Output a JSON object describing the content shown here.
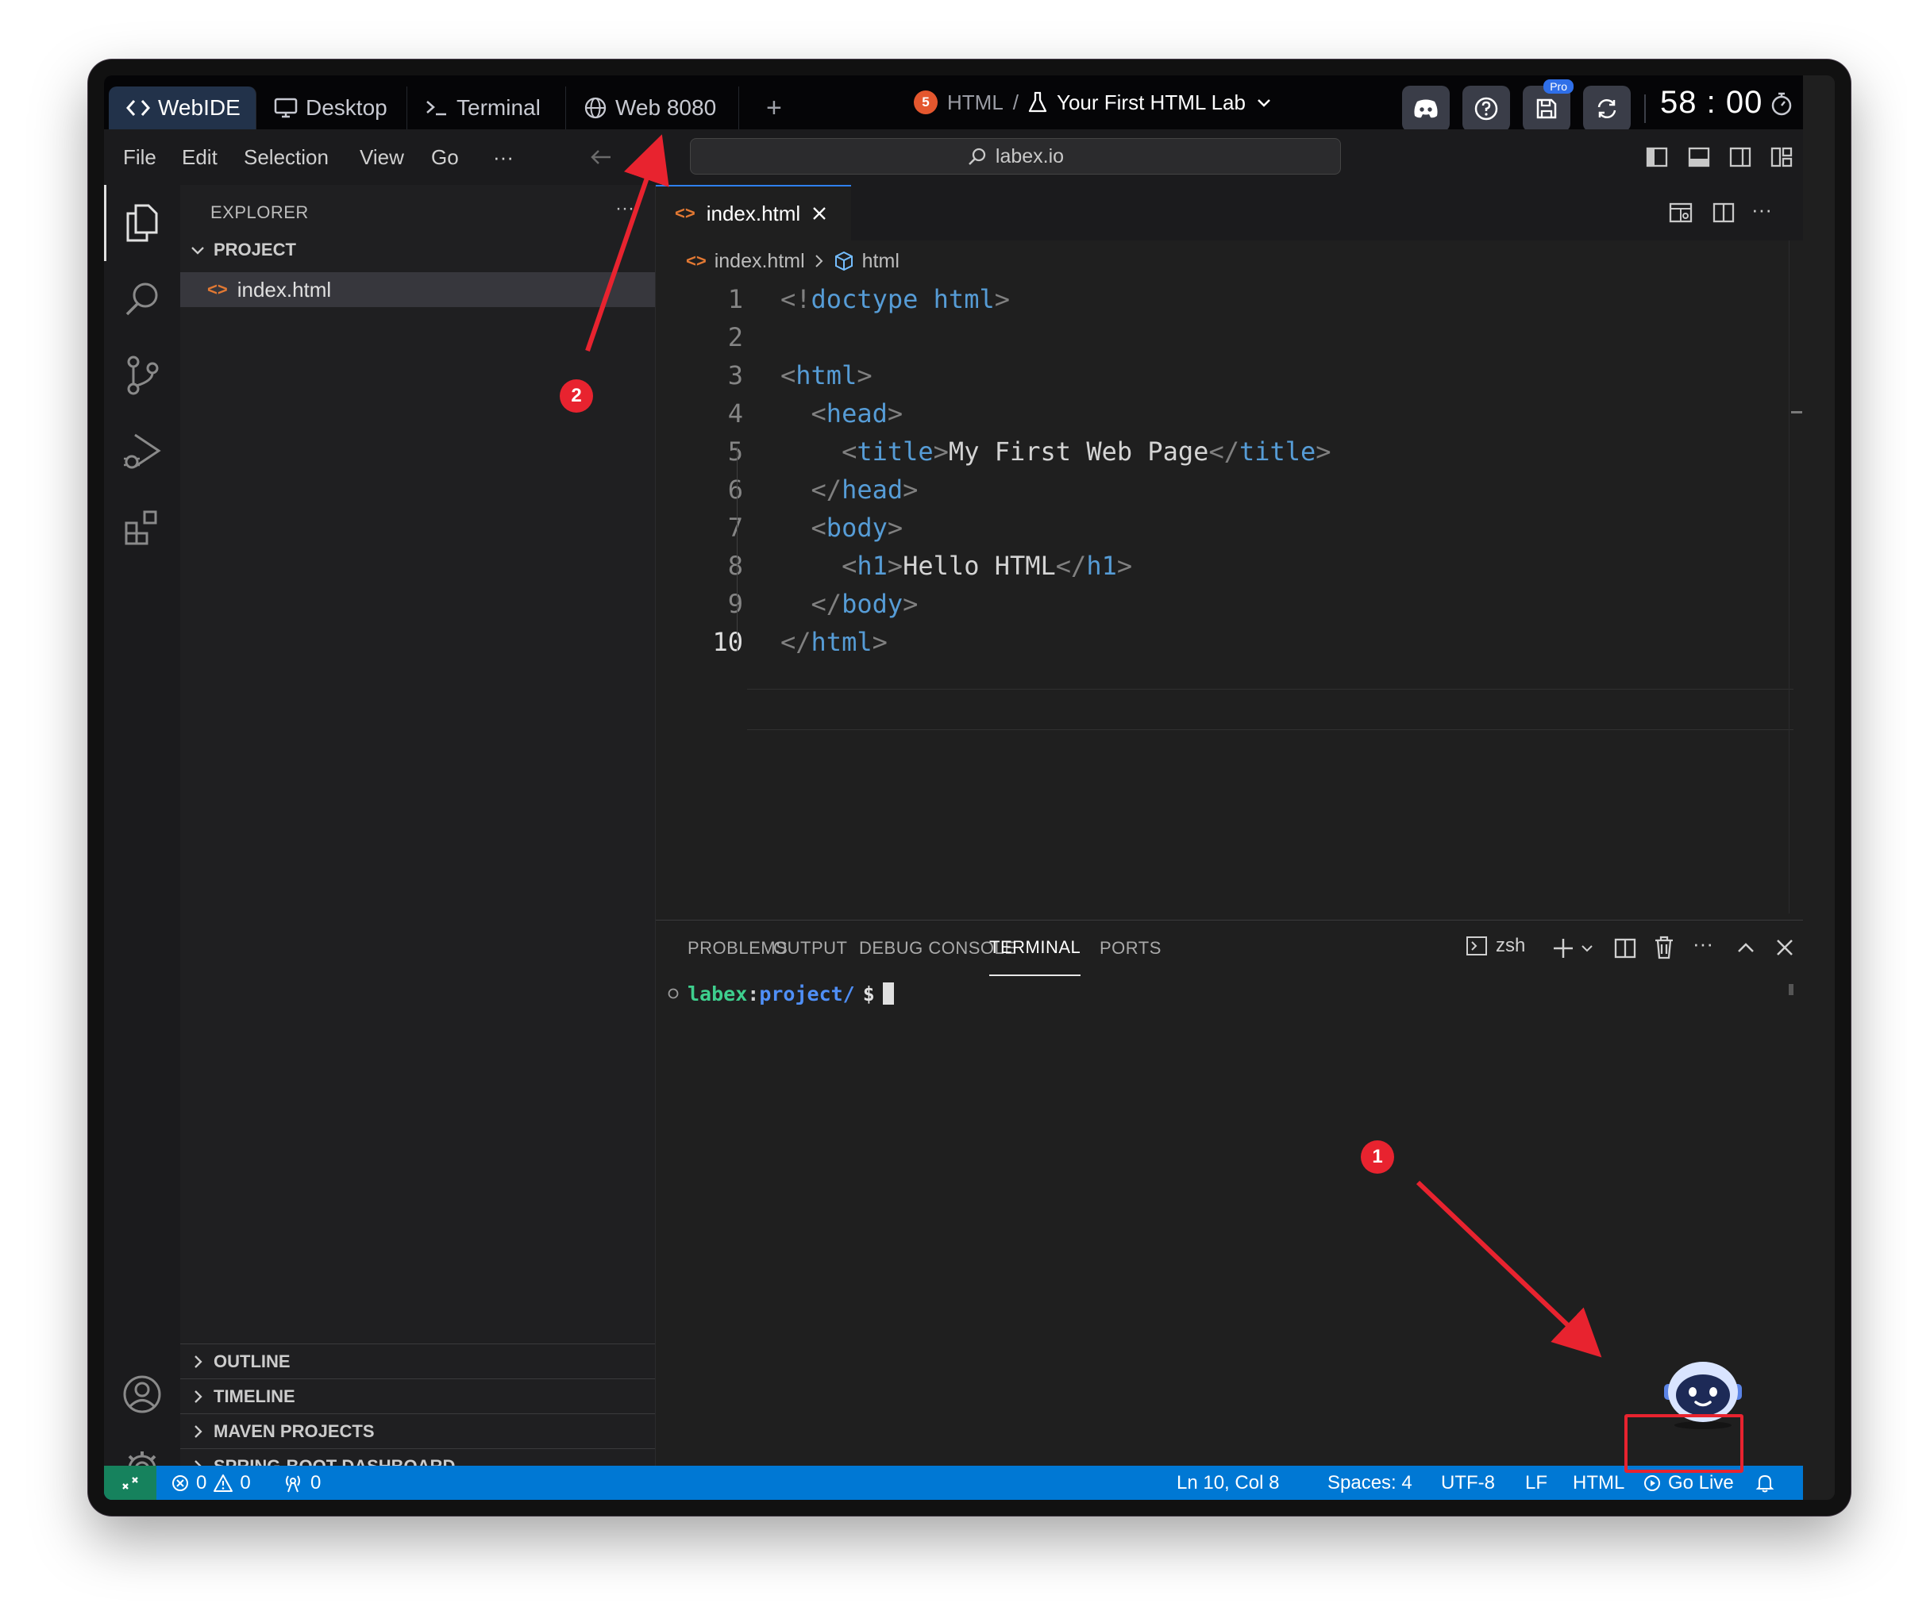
{
  "topbar": {
    "tabs": [
      {
        "label": "WebIDE",
        "icon": "code-brackets-icon"
      },
      {
        "label": "Desktop",
        "icon": "monitor-icon"
      },
      {
        "label": "Terminal",
        "icon": "terminal-prompt-icon"
      },
      {
        "label": "Web 8080",
        "icon": "globe-icon"
      }
    ],
    "add_tab": "+",
    "course": "HTML",
    "separator": "/",
    "lab_name": "Your First HTML Lab",
    "pro_badge": "Pro",
    "timer": "58 : 00"
  },
  "menu": {
    "items": [
      "File",
      "Edit",
      "Selection",
      "View",
      "Go"
    ],
    "more": "···",
    "search_text": "labex.io"
  },
  "sidebar": {
    "title": "EXPLORER",
    "more": "···",
    "project": "PROJECT",
    "file": "index.html",
    "sections": [
      "OUTLINE",
      "TIMELINE",
      "MAVEN PROJECTS",
      "SPRING-BOOT DASHBOARD"
    ]
  },
  "editor": {
    "tab_label": "index.html",
    "breadcrumb_file": "index.html",
    "breadcrumb_symbol": "html",
    "more": "···",
    "lines": [
      {
        "n": "1",
        "parts": [
          [
            "pn",
            "<!"
          ],
          [
            "tg",
            "doctype "
          ],
          [
            "tg",
            "html"
          ],
          [
            "pn",
            ">"
          ]
        ]
      },
      {
        "n": "2",
        "parts": []
      },
      {
        "n": "3",
        "parts": [
          [
            "pn",
            "<"
          ],
          [
            "tg",
            "html"
          ],
          [
            "pn",
            ">"
          ]
        ]
      },
      {
        "n": "4",
        "parts": [
          [
            "tx",
            "  "
          ],
          [
            "pn",
            "<"
          ],
          [
            "tg",
            "head"
          ],
          [
            "pn",
            ">"
          ]
        ]
      },
      {
        "n": "5",
        "parts": [
          [
            "tx",
            "    "
          ],
          [
            "pn",
            "<"
          ],
          [
            "tg",
            "title"
          ],
          [
            "pn",
            ">"
          ],
          [
            "tx",
            "My First Web Page"
          ],
          [
            "pn",
            "</"
          ],
          [
            "tg",
            "title"
          ],
          [
            "pn",
            ">"
          ]
        ]
      },
      {
        "n": "6",
        "parts": [
          [
            "tx",
            "  "
          ],
          [
            "pn",
            "</"
          ],
          [
            "tg",
            "head"
          ],
          [
            "pn",
            ">"
          ]
        ]
      },
      {
        "n": "7",
        "parts": [
          [
            "tx",
            "  "
          ],
          [
            "pn",
            "<"
          ],
          [
            "tg",
            "body"
          ],
          [
            "pn",
            ">"
          ]
        ]
      },
      {
        "n": "8",
        "parts": [
          [
            "tx",
            "    "
          ],
          [
            "pn",
            "<"
          ],
          [
            "tg",
            "h1"
          ],
          [
            "pn",
            ">"
          ],
          [
            "tx",
            "Hello HTML"
          ],
          [
            "pn",
            "</"
          ],
          [
            "tg",
            "h1"
          ],
          [
            "pn",
            ">"
          ]
        ]
      },
      {
        "n": "9",
        "parts": [
          [
            "tx",
            "  "
          ],
          [
            "pn",
            "</"
          ],
          [
            "tg",
            "body"
          ],
          [
            "pn",
            ">"
          ]
        ]
      },
      {
        "n": "10",
        "parts": [
          [
            "pn",
            "</"
          ],
          [
            "tg",
            "html"
          ],
          [
            "pn",
            ">"
          ]
        ]
      }
    ]
  },
  "panel": {
    "tabs": [
      "PROBLEMS",
      "OUTPUT",
      "DEBUG CONSOLE",
      "TERMINAL",
      "PORTS"
    ],
    "active_tab": "TERMINAL",
    "shell": "zsh",
    "more": "···",
    "prompt_host": "labex",
    "prompt_colon": ":",
    "prompt_path": "project/",
    "prompt_symbol": "$"
  },
  "status": {
    "errors": "0",
    "warnings": "0",
    "ports": "0",
    "position": "Ln 10, Col 8",
    "spaces": "Spaces: 4",
    "encoding": "UTF-8",
    "eol": "LF",
    "language": "HTML",
    "go_live": "Go Live"
  },
  "annotations": {
    "badge1": "1",
    "badge2": "2"
  },
  "colors": {
    "accent": "#0078d4",
    "remote": "#16825d",
    "annotation": "#e8232f",
    "tag": "#569cd6",
    "prompt_host": "#3ecf8e",
    "prompt_path": "#4f8ff7"
  }
}
